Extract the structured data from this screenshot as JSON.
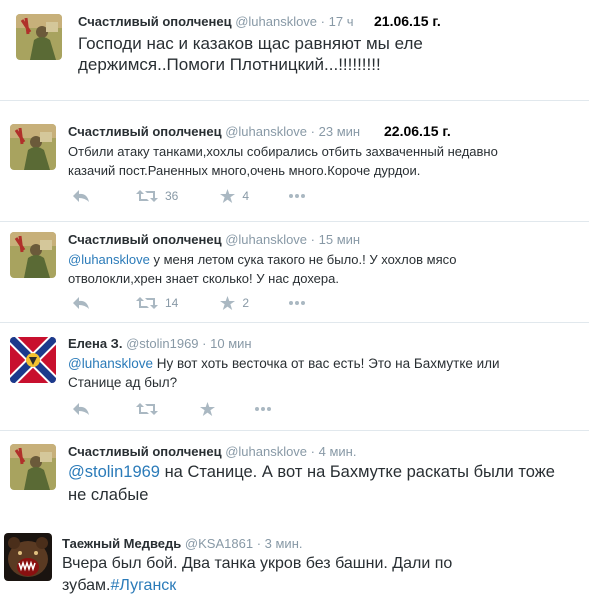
{
  "tweets": [
    {
      "name": "Счастливый ополченец",
      "handle": "@luhansklove",
      "time": "17 ч",
      "date_stamp": "21.06.15 г.",
      "text": "Господи нас и казаков щас равняют мы еле держимся..Помоги Плотницкий...!!!!!!!!!"
    },
    {
      "name": "Счастливый ополченец",
      "handle": "@luhansklove",
      "time": "23 мин",
      "date_stamp": "22.06.15 г.",
      "text": "Отбили атаку танками,хохлы собирались отбить захваченный недавно казачий пост.Раненных много,очень много.Короче дурдои.",
      "retweets": "36",
      "favorites": "4"
    },
    {
      "name": "Счастливый ополченец",
      "handle": "@luhansklove",
      "time": "15 мин",
      "mention": "@luhansklove",
      "text": " у меня летом сука такого не было.! У хохлов мясо отволокли,хрен знает сколько! У нас дохера.",
      "retweets": "14",
      "favorites": "2"
    },
    {
      "name": "Елена З.",
      "handle": "@stolin1969",
      "time": "10 мин",
      "mention": "@luhansklove",
      "text": " Ну вот хоть весточка от вас есть! Это на Бахмутке или Станице ад был?"
    },
    {
      "name": "Счастливый ополченец",
      "handle": "@luhansklove",
      "time": "4 мин.",
      "mention": "@stolin1969",
      "text": " на Станице. А вот на Бахмутке раскаты были тоже не слабые"
    },
    {
      "name": "Таежный Медведь",
      "handle": "@KSA1861",
      "time": "3 мин.",
      "text": "Вчера был бой. Два танка укров без башни. Дали по зубам.",
      "hashtag": "#Луганск"
    }
  ],
  "separator": "·",
  "colors": {
    "link": "#2b7bb9",
    "muted": "#8899a6",
    "icon": "#aab8c2",
    "divider": "#e1e8ed"
  },
  "icons": [
    "reply-icon",
    "retweet-icon",
    "favorite-icon",
    "more-icon"
  ]
}
